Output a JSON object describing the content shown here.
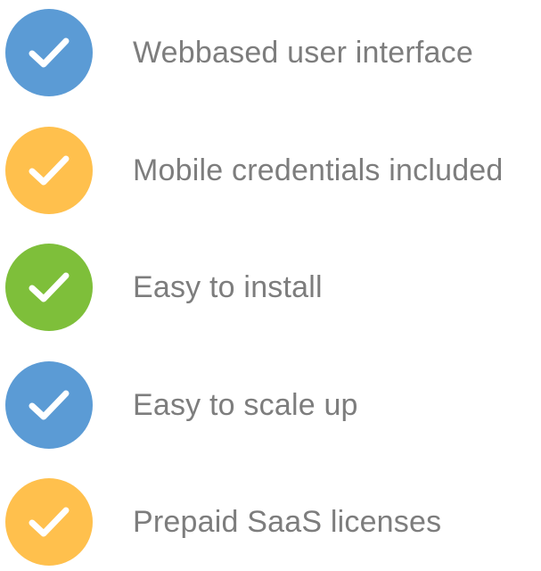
{
  "features": [
    {
      "label": "Webbased user interface",
      "icon": "check-icon",
      "color": "#5b9bd5"
    },
    {
      "label": "Mobile credentials included",
      "icon": "check-icon",
      "color": "#ffc04d"
    },
    {
      "label": "Easy to install",
      "icon": "check-icon",
      "color": "#7ebf3a"
    },
    {
      "label": "Easy to scale up",
      "icon": "check-icon",
      "color": "#5b9bd5"
    },
    {
      "label": "Prepaid SaaS licenses",
      "icon": "check-icon",
      "color": "#ffc04d"
    }
  ]
}
